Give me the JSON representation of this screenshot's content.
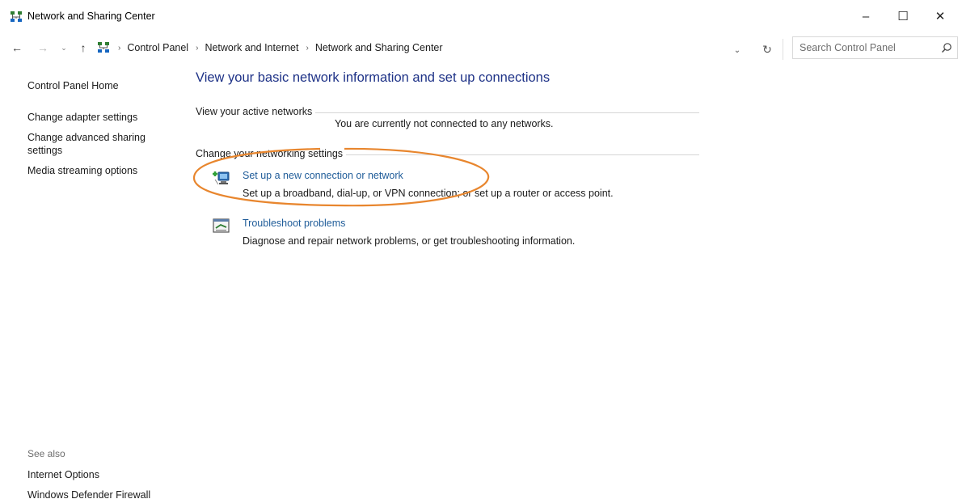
{
  "window": {
    "title": "Network and Sharing Center",
    "controls": {
      "minimize": "–",
      "maximize": "☐",
      "close": "✕"
    }
  },
  "nav": {
    "back": "←",
    "forward": "→",
    "recent": "⌄",
    "up": "↑",
    "breadcrumb": [
      "Control Panel",
      "Network and Internet",
      "Network and Sharing Center"
    ],
    "dropdown": "⌄",
    "refresh": "↻"
  },
  "search": {
    "placeholder": "Search Control Panel",
    "value": ""
  },
  "left_pane": {
    "home": "Control Panel Home",
    "links": [
      "Change adapter settings",
      "Change advanced sharing settings",
      "Media streaming options"
    ]
  },
  "see_also": {
    "title": "See also",
    "links": [
      "Internet Options",
      "Windows Defender Firewall"
    ]
  },
  "main": {
    "title": "View your basic network information and set up connections",
    "active_networks": {
      "label": "View your active networks",
      "status": "You are currently not connected to any networks."
    },
    "change_settings": {
      "label": "Change your networking settings",
      "tasks": [
        {
          "link": "Set up a new connection or network",
          "desc": "Set up a broadband, dial-up, or VPN connection; or set up a router or access point."
        },
        {
          "link": "Troubleshoot problems",
          "desc": "Diagnose and repair network problems, or get troubleshooting information."
        }
      ]
    }
  },
  "colors": {
    "title_blue": "#1e3287",
    "link_blue": "#1f5c99",
    "highlight_orange": "#e8862e"
  }
}
